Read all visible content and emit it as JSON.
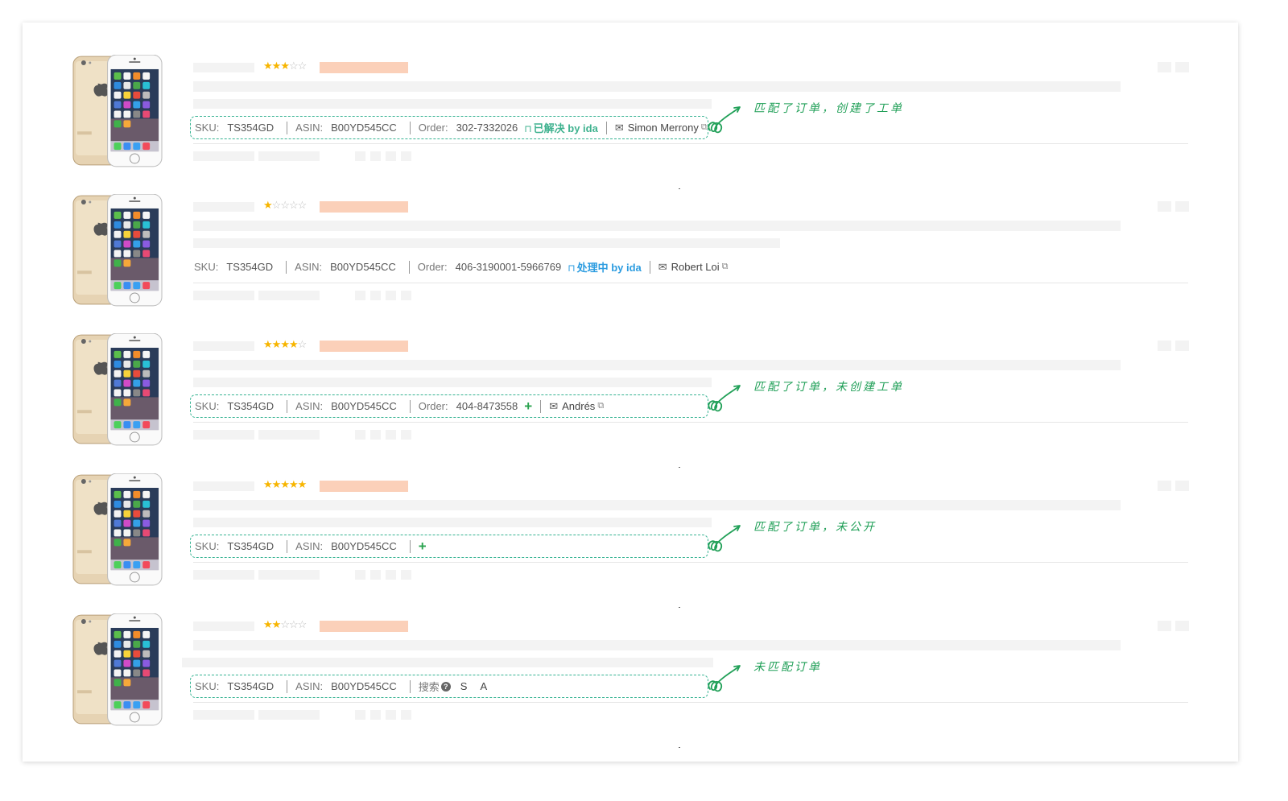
{
  "labels": {
    "sku": "SKU:",
    "asin": "ASIN:",
    "order": "Order:"
  },
  "icons": {
    "bookmark": "bookmark-icon",
    "mail": "mail-icon",
    "copy": "copy-icon",
    "add": "plus-icon",
    "help": "question-icon",
    "curl_arrow": "curl-arrow-icon"
  },
  "colors": {
    "dashed_border": "#36b392",
    "note_green": "#21a058",
    "resolved": "#3fb28f",
    "processing": "#2c9ce0",
    "plus": "#2aa34f",
    "star": "#f7b500"
  },
  "reviews": [
    {
      "rating": 3,
      "sku": "TS354GD",
      "asin": "B00YD545CC",
      "order": "302-7332026",
      "status": "已解决 by ida",
      "customer": "Simon Merrony",
      "note": "匹配了订单，创建了工单"
    },
    {
      "rating": 1,
      "sku": "TS354GD",
      "asin": "B00YD545CC",
      "order": "406-3190001-5966769",
      "status": "处理中 by ida",
      "customer": "Robert Loi"
    },
    {
      "rating": 4,
      "sku": "TS354GD",
      "asin": "B00YD545CC",
      "order": "404-8473558",
      "customer": "Andrés",
      "note": "匹配了订单，未创建工单"
    },
    {
      "rating": 5,
      "sku": "TS354GD",
      "asin": "B00YD545CC",
      "note": "匹配了订单，未公开"
    },
    {
      "rating": 2,
      "sku": "TS354GD",
      "asin": "B00YD545CC",
      "search_label": "搜索",
      "search_letters": [
        "S",
        "A"
      ],
      "note": "未匹配订单"
    }
  ]
}
